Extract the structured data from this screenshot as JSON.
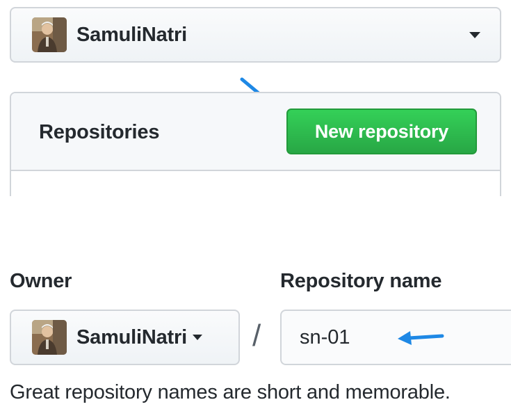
{
  "account_switcher": {
    "username": "SamuliNatri"
  },
  "repositories_panel": {
    "title": "Repositories",
    "new_button_label": "New repository"
  },
  "form": {
    "owner_label": "Owner",
    "owner_value": "SamuliNatri",
    "separator": "/",
    "repo_name_label": "Repository name",
    "repo_name_value": "sn-01",
    "hint": "Great repository names are short and memorable."
  },
  "colors": {
    "button_green": "#28a745",
    "annotation_arrow": "#1e88e5",
    "border": "#d1d5da"
  },
  "icons": {
    "avatar": "avatar",
    "dropdown": "caret-down-icon",
    "annotation": "arrow-icon"
  }
}
